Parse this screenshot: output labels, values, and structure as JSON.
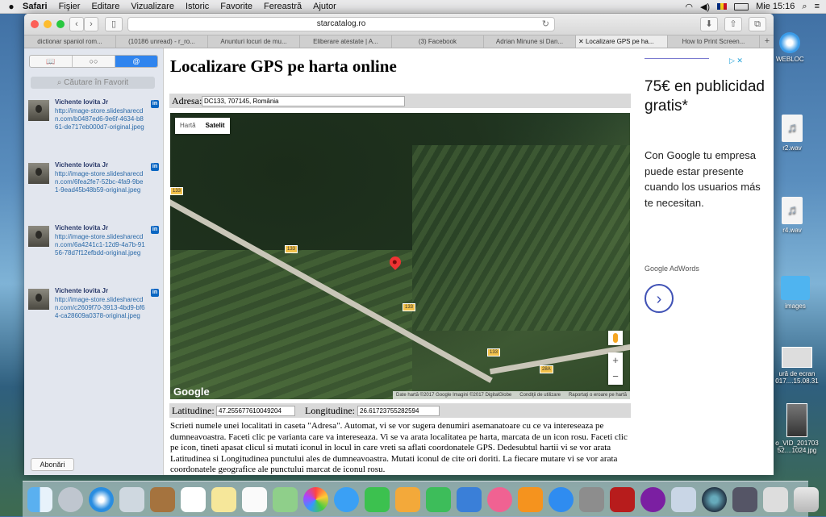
{
  "menubar": {
    "apple": "",
    "items": [
      "Safari",
      "Fişier",
      "Editare",
      "Vizualizare",
      "Istoric",
      "Favorite",
      "Fereastră",
      "Ajutor"
    ],
    "clock": "Mie 15:16"
  },
  "browser": {
    "url": "starcatalog.ro",
    "tabs": [
      "dictionar spaniol rom...",
      "(10186 unread) - r_ro...",
      "Anunturi locuri de mu...",
      "Eliberare atestate | A...",
      "(3) Facebook",
      "Adrian Minune si Dan...",
      "Localizare GPS pe ha...",
      "How to Print Screen..."
    ],
    "active_tab": 6
  },
  "sidebar": {
    "search_placeholder": "Căutare în Favorit",
    "items": [
      {
        "name": "Vichente Iovita  Jr",
        "url": "http://image-store.slidesharecdn.com/b0487ed6-9e6f-4634-b861-de717eb000d7-original.jpeg"
      },
      {
        "name": "Vichente Iovita  Jr",
        "url": "http://image-store.slidesharecdn.com/6fea2fe7-52bc-4fa9-9be1-9ead45b48b59-original.jpeg"
      },
      {
        "name": "Vichente Iovita  Jr",
        "url": "http://image-store.slidesharecdn.com/6a4241c1-12d9-4a7b-9156-78d7f12efbdd-original.jpeg"
      },
      {
        "name": "Vichente Iovita  Jr",
        "url": "http://image-store.slidesharecdn.com/c2609f70-3913-4bd9-bf64-ca28609a0378-original.jpeg"
      }
    ],
    "subscribe": "Abonări"
  },
  "page": {
    "title": "Localizare GPS pe harta online",
    "address_label": "Adresa:",
    "address_value": "DC133, 707145, România",
    "map": {
      "type_map": "Hartă",
      "type_satellite": "Satelit",
      "road_labels": [
        "133",
        "133",
        "133",
        "133",
        "28A"
      ],
      "logo": "Google",
      "attribution": "Date hartă ©2017 Google Imagini ©2017 DigitalGlobe",
      "terms": "Condiţii de utilizare",
      "report": "Raportaţi o eroare pe hartă",
      "zoom_in": "+",
      "zoom_out": "−"
    },
    "lat_label": "Latitudine:",
    "lat_value": "47.255677610049204",
    "lng_label": "Longitudine:",
    "lng_value": "26.61723755282594",
    "description": "Scrieti numele unei localitati in caseta \"Adresa\". Automat, vi se vor sugera denumiri asemanatoare cu ce va intereseaza pe dumneavoastra. Faceti clic pe varianta care va intereseaza. Vi se va arata localitatea pe harta, marcata de un icon rosu. Faceti clic pe icon, tineti apasat clicul si mutati iconul in locul in care vreti sa aflati coordonatele GPS. Dedesubtul hartii vi se vor arata Latitudinea si Longitudinea punctului ales de dumneavoastra. Mutati iconul de cite ori doriti. La fiecare mutare vi se vor arata coordonatele geografice ale punctului marcat de iconul rosu."
  },
  "ad": {
    "headline": "75€ en publicidad gratis*",
    "body": "Con Google tu empresa puede estar presente cuando los usuarios más te necesitan.",
    "brand": "Google AdWords"
  },
  "desktop": {
    "icons": [
      {
        "label": "WEBLOC",
        "name": "webloc"
      },
      {
        "label": "r2.wav",
        "name": "r2"
      },
      {
        "label": "r4.wav",
        "name": "r4"
      },
      {
        "label": "images",
        "name": "images"
      },
      {
        "label": "ură de ecran 017....15.08.31",
        "name": "screenshot"
      },
      {
        "label": "o_VID_201703 52....1024.jpg",
        "name": "vid"
      }
    ]
  },
  "colors": {
    "accent": "#2f84ee",
    "pin": "#e33333",
    "ad_blue": "#3f51b5"
  }
}
